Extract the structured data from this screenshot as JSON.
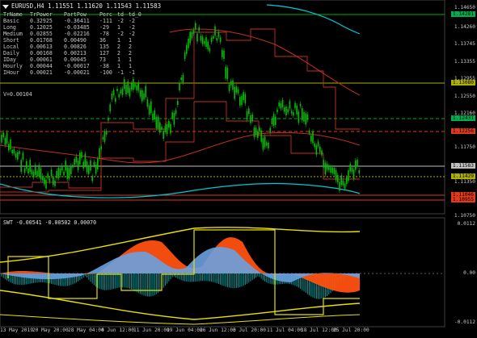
{
  "main_title": {
    "text": "EURUSD,H4  1.11551 1.11620 1.11543 1.11583"
  },
  "table": {
    "headers": [
      "TrName",
      "TrPower",
      "PartPow",
      "Perc",
      "td",
      "td_0"
    ],
    "rows": [
      [
        "Basic",
        "0.32925",
        "-0.36411",
        "-111",
        "-2",
        "-2"
      ],
      [
        "Long",
        "0.12025",
        "-0.03485",
        "-29",
        "1",
        "-2"
      ],
      [
        "Medium",
        "0.02855",
        "-0.02216",
        "-78",
        "-2",
        "-2"
      ],
      [
        "Short",
        "0.01768",
        "0.00490",
        "36",
        "1",
        "1"
      ],
      [
        "Local",
        "0.00613",
        "0.00826",
        "135",
        "2",
        "2"
      ],
      [
        "Daily",
        "0.00168",
        "0.00213",
        "127",
        "2",
        "2"
      ],
      [
        "IDay",
        "0.00061",
        "0.00045",
        "73",
        "1",
        "1"
      ],
      [
        "Hourly",
        "0.00044",
        "-0.00017",
        "-38",
        "1",
        "1"
      ],
      [
        "IHour",
        "0.00021",
        "-0.00021",
        "-100",
        "-1",
        "-1"
      ]
    ],
    "tr_line": "V=0.00104"
  },
  "price_axis": {
    "labels": [
      "1.14650",
      "1.14260",
      "1.13745",
      "1.13355",
      "1.12955",
      "1.12550",
      "1.12160",
      "1.11750",
      "1.11350",
      "1.10950",
      "1.10750"
    ],
    "tags": [
      {
        "text": "1.14281",
        "bg": "#00b050"
      },
      {
        "text": "1.13080",
        "bg": "#b0b000"
      },
      {
        "text": "1.12431",
        "bg": "#00b050"
      },
      {
        "text": "1.12256",
        "bg": "#e03a1a"
      },
      {
        "text": "1.11583",
        "bg": "#c0c0c0"
      },
      {
        "text": "1.11429",
        "bg": "#b0b000"
      },
      {
        "text": "1.11046",
        "bg": "#e03a1a"
      },
      {
        "text": "1.10955",
        "bg": "#e03a1a"
      }
    ]
  },
  "swt": {
    "title": "SWT -0.00541 -0.00502 0.00070",
    "labels": [
      "0.0112",
      "0.00",
      "-0.0112"
    ]
  },
  "time_axis": {
    "labels": [
      "13 May 2019",
      "20 May 20:00",
      "28 May 04:00",
      "4 Jun 12:00",
      "11 Jun 20:00",
      "19 Jun 04:00",
      "26 Jun 12:00",
      "3 Jul 20:00",
      "11 Jul 04:00",
      "18 Jul 12:00",
      "25 Jul 20:00"
    ]
  },
  "colors": {
    "background": "#000000",
    "candles": "#00c000",
    "ma_cyan": "#00c8d8",
    "ma_red": "#c03020",
    "level_yellow": "#c8c800",
    "level_green": "#00b000",
    "osc_orange": "#ff5010",
    "osc_blue": "#6aa0e0",
    "osc_yellow": "#e8e000",
    "osc_teal": "#00a0a0"
  }
}
